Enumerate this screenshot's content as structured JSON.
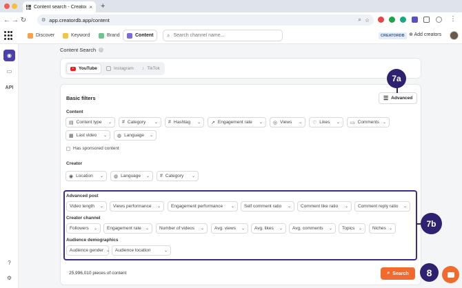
{
  "browser": {
    "tab_title": "Content search - CreatorDB",
    "url": "app.creatordb.app/content"
  },
  "header": {
    "nav": [
      {
        "label": "Discover"
      },
      {
        "label": "Keyword"
      },
      {
        "label": "Brand"
      },
      {
        "label": "Content"
      }
    ],
    "search_placeholder": "Search channel name...",
    "brand_badge": "CREATORDB",
    "add_creators": "Add creators"
  },
  "sidebar": {
    "api_label": "API"
  },
  "page": {
    "title": "Content Search"
  },
  "platforms": [
    "YouTube",
    "Instagram",
    "TikTok"
  ],
  "basic_filters": {
    "title": "Basic filters",
    "advanced_label": "Advanced",
    "content_label": "Content",
    "content_filters": [
      "Content type",
      "Category",
      "Hashtag",
      "Engagement rate",
      "Views",
      "Likes",
      "Comments",
      "Last video",
      "Language"
    ],
    "sponsored_label": "Has sponsored content",
    "creator_label": "Creator",
    "creator_filters": [
      "Location",
      "Language",
      "Category"
    ]
  },
  "advanced": {
    "advanced_post_label": "Advanced post",
    "advanced_post_filters": [
      "Video length",
      "Views performance",
      "Engagement performance",
      "Self comment ratio",
      "Comment like ratio",
      "Comment reply ratio"
    ],
    "creator_channel_label": "Creator channel",
    "creator_channel_filters": [
      "Followers",
      "Engagement rate",
      "Number of videos",
      "Avg. views",
      "Avg. likes",
      "Avg. comments",
      "Topics",
      "Niches"
    ],
    "audience_label": "Audience demographics",
    "audience_filters": [
      "Audience gender",
      "Audience location"
    ]
  },
  "footer": {
    "count_text": "25,996,010 pieces of content",
    "search_label": "Search"
  },
  "callouts": {
    "advanced": "7a",
    "advanced_section": "7b",
    "search": "8"
  },
  "colors": {
    "accent_orange": "#f26b2e",
    "callout_navy": "#2e2270",
    "rail_active": "#4b3fa8"
  }
}
